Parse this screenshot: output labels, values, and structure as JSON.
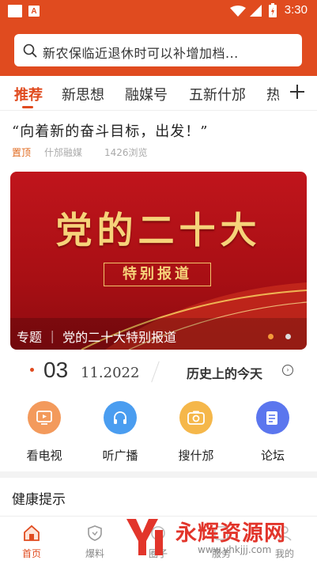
{
  "status_bar": {
    "time": "3:30"
  },
  "search": {
    "placeholder": "新农保临近退休时可以补增加档..."
  },
  "tabs": [
    {
      "label": "推荐",
      "active": true
    },
    {
      "label": "新思想",
      "active": false
    },
    {
      "label": "融媒号",
      "active": false
    },
    {
      "label": "五新什邡",
      "active": false
    },
    {
      "label": "热",
      "active": false
    }
  ],
  "headline": {
    "title": "“向着新的奋斗目标，出发！”",
    "pin": "置顶",
    "source": "什邡融媒",
    "views": "1426浏览"
  },
  "banner": {
    "title": "党的二十大",
    "tag": "特别报道",
    "caption": "专题 ｜ 党的二十大特别报道"
  },
  "date": {
    "day": "03",
    "month_year": "11.2022",
    "history_label": "历史上的今天"
  },
  "quick_links": [
    {
      "label": "看电视",
      "icon": "tv-icon",
      "color": "#f39a5c"
    },
    {
      "label": "听广播",
      "icon": "headphones-icon",
      "color": "#4a9df0"
    },
    {
      "label": "搜什邡",
      "icon": "camera-icon",
      "color": "#f5b74a"
    },
    {
      "label": "论坛",
      "icon": "forum-icon",
      "color": "#5b76ee"
    }
  ],
  "section": {
    "health_title": "健康提示"
  },
  "bottom_nav": [
    {
      "label": "首页",
      "icon": "home-icon",
      "active": true
    },
    {
      "label": "爆料",
      "icon": "shield-icon",
      "active": false
    },
    {
      "label": "圈子",
      "icon": "circle-icon",
      "active": false
    },
    {
      "label": "服务",
      "icon": "service-icon",
      "active": false
    },
    {
      "label": "我的",
      "icon": "user-icon",
      "active": false
    }
  ],
  "watermark": {
    "name": "永辉资源网",
    "url": "www.yhkjjj.com"
  },
  "colors": {
    "brand": "#e04b1f",
    "banner_red": "#b5121a",
    "gold": "#f6d37a"
  }
}
